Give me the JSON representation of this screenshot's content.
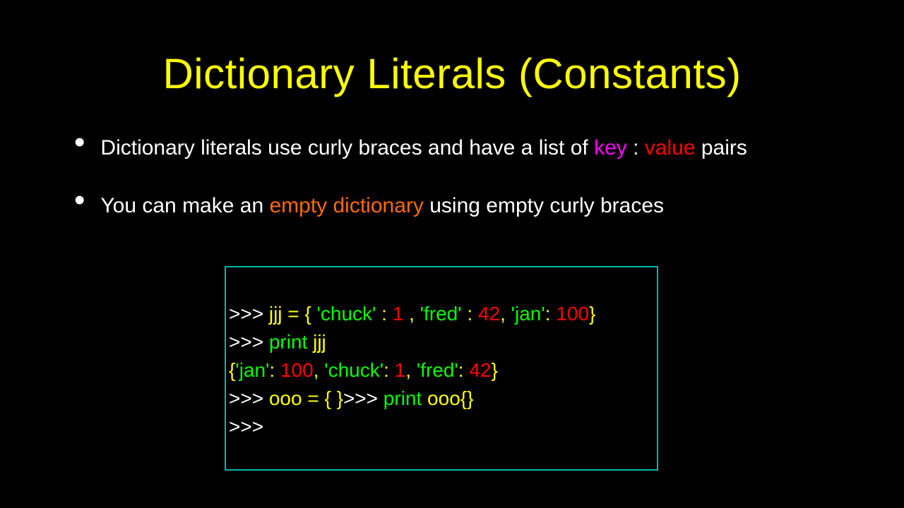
{
  "title": "Dictionary Literals (Constants)",
  "bullets": {
    "b1": {
      "pre": "Dictionary literals use curly braces and have a list of ",
      "key": "key",
      "colon": " : ",
      "value": "value",
      "post": " pairs"
    },
    "b2": {
      "pre": "You can make an ",
      "empty": "empty dictionary",
      "post": " using empty curly braces"
    }
  },
  "code": {
    "l1": {
      "p1": ">>> ",
      "p2": "jjj = { ",
      "p3": "'chuck'",
      "p4": " : ",
      "p5": "1",
      "p6": " , ",
      "p7": "'fred'",
      "p8": " : ",
      "p9": "42",
      "p10": ", ",
      "p11": "'jan'",
      "p12": ": ",
      "p13": "100",
      "p14": "}"
    },
    "l2": {
      "p1": ">>> ",
      "p2": "print ",
      "p3": "jjj"
    },
    "l3": {
      "p1": "{",
      "p2": "'jan'",
      "p3": ": ",
      "p4": "100",
      "p5": ", ",
      "p6": "'chuck'",
      "p7": ": ",
      "p8": "1",
      "p9": ", ",
      "p10": "'fred'",
      "p11": ": ",
      "p12": "42",
      "p13": "}"
    },
    "l4": {
      "p1": ">>> ",
      "p2": "ooo = { }",
      "p3": ">>> ",
      "p4": "print ",
      "p5": "ooo",
      "p6": "{}"
    },
    "l5": {
      "p1": ">>>"
    }
  }
}
